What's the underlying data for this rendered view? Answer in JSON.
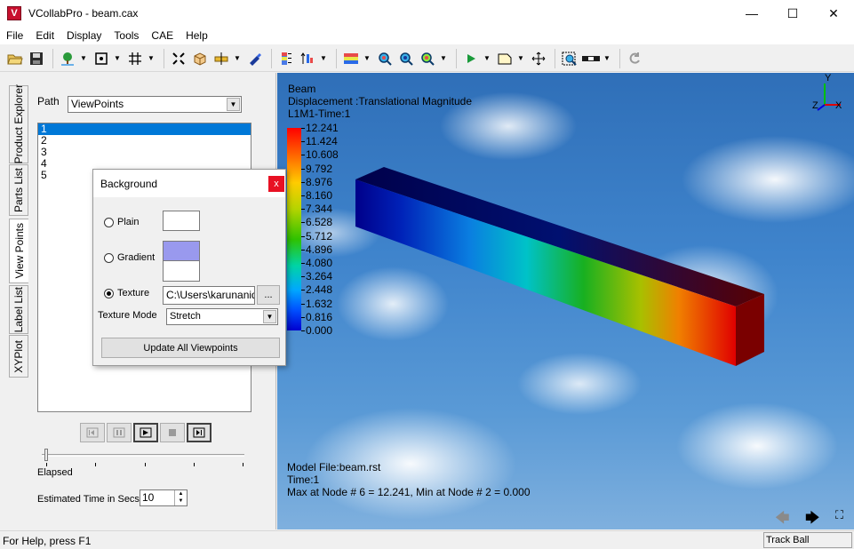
{
  "window": {
    "title": "VCollabPro - beam.cax",
    "minimize": "—",
    "maximize": "☐",
    "close": "✕"
  },
  "menu": [
    "File",
    "Edit",
    "Display",
    "Tools",
    "CAE",
    "Help"
  ],
  "side_tabs": [
    "Product Explorer",
    "Parts List",
    "View Points",
    "Label List",
    "XYPlot"
  ],
  "viewpoints_panel": {
    "path_label": "Path",
    "path_value": "ViewPoints",
    "items": [
      "1",
      "2",
      "3",
      "4",
      "5"
    ],
    "selected_index": 0,
    "elapsed_label": "Elapsed",
    "estimated_label": "Estimated Time in Secs.",
    "estimated_value": "10"
  },
  "background_dialog": {
    "title": "Background",
    "close": "x",
    "options": [
      "Plain",
      "Gradient",
      "Texture"
    ],
    "selected_option": "Texture",
    "texture_path": "C:\\Users\\karunanidh",
    "browse_label": "...",
    "texture_mode_label": "Texture Mode",
    "texture_mode_value": "Stretch",
    "update_button": "Update All Viewpoints",
    "gradient_top_color": "#9999ee",
    "gradient_bottom_color": "#ffffff"
  },
  "viewport": {
    "model_name": "Beam",
    "result_label": "Displacement :Translational Magnitude",
    "case_label": "L1M1-Time:1",
    "legend_values": [
      "12.241",
      "11.424",
      "10.608",
      "9.792",
      "8.976",
      "8.160",
      "7.344",
      "6.528",
      "5.712",
      "4.896",
      "4.080",
      "3.264",
      "2.448",
      "1.632",
      "0.816",
      "0.000"
    ],
    "model_file": "Model File:beam.rst",
    "time": "Time:1",
    "max_min": "Max at Node # 6 = 12.241, Min at Node # 2 = 0.000",
    "axis_y": "Y",
    "axis_z": "Z",
    "axis_x": "X"
  },
  "status": {
    "help": "For Help, press F1",
    "mode": "Track Ball"
  }
}
